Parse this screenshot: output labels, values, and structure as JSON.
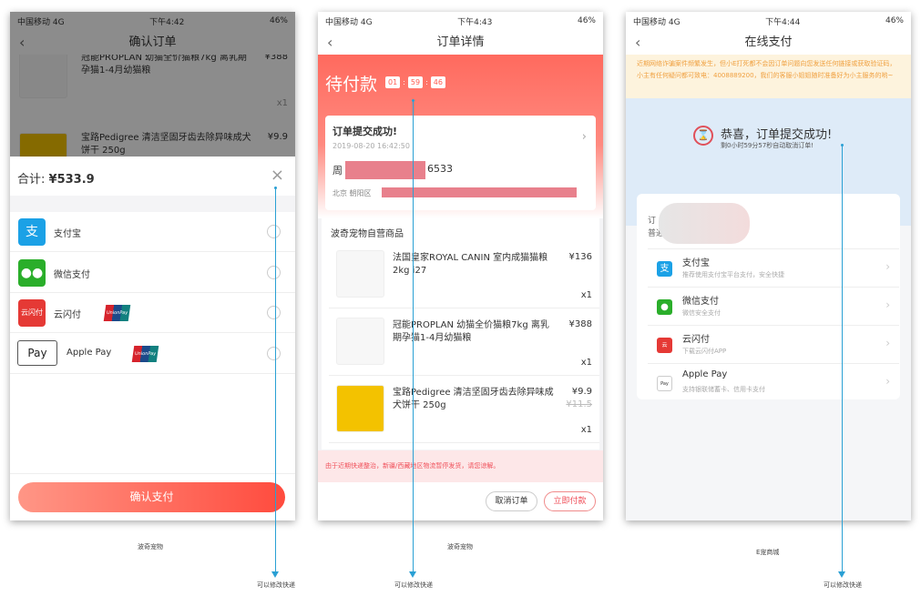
{
  "screen1": {
    "status": {
      "carrier": "中国移动",
      "network": "4G",
      "time": "下午4:42",
      "battery": "46%"
    },
    "title": "确认订单",
    "background_items": [
      {
        "name": "冠能PROPLAN 幼猫全价猫粮7kg 离乳期孕猫1-4月幼猫粮",
        "price": "¥388",
        "qty": "x1"
      },
      {
        "name": "宝路Pedigree 清洁坚固牙齿去除异味成犬饼干 250g",
        "price": "¥9.9"
      }
    ],
    "total_label": "合计:",
    "total_value": "¥533.9",
    "payment_methods": [
      {
        "label": "支付宝",
        "icon": "alipay-icon"
      },
      {
        "label": "微信支付",
        "icon": "wechat-pay-icon"
      },
      {
        "label": "云闪付",
        "icon": "cloud-quickpass-icon",
        "badge": "UnionPay 银联"
      },
      {
        "label": "Apple Pay",
        "icon": "apple-pay-icon",
        "icon_text": "Pay",
        "badge": "UnionPay 银联"
      }
    ],
    "confirm_label": "确认支付",
    "caption": "波奇宠物"
  },
  "screen2": {
    "status": {
      "carrier": "中国移动",
      "network": "4G",
      "time": "下午4:43",
      "battery": "46%"
    },
    "title": "订单详情",
    "pending_label": "待付款",
    "countdown": [
      "01",
      "59",
      "46"
    ],
    "order_success": "订单提交成功!",
    "order_time": "2019-08-20 16:42:50",
    "recipient_prefix": "周",
    "recipient_suffix": "6533",
    "address_prefix": "北京 朝阳区",
    "store_name": "波奇宠物自营商品",
    "products": [
      {
        "name": "法国皇家ROYAL CANIN 室内成猫猫粮2kg i27",
        "price": "¥136",
        "qty": "x1"
      },
      {
        "name": "冠能PROPLAN 幼猫全价猫粮7kg 离乳期孕猫1-4月幼猫粮",
        "price": "¥388",
        "qty": "x1"
      },
      {
        "name": "宝路Pedigree 清洁坚固牙齿去除异味成犬饼干 250g",
        "price": "¥9.9",
        "original_price": "¥11.5",
        "qty": "x1"
      }
    ],
    "notice": "由于近期快递整治，新疆/西藏地区物流暂停发货，请您谅解。",
    "cancel_label": "取消订单",
    "pay_label": "立即付款",
    "caption": "波奇宠物"
  },
  "screen3": {
    "status": {
      "carrier": "中国移动",
      "network": "4G",
      "time": "下午4:44",
      "battery": "46%"
    },
    "title": "在线支付",
    "warning": "近期网络诈骗案件频繁发生，但小E打死都不会因订单问题向您发送任何链接或获取验证码，小主有任何疑问都可致电：4008889200，我们的客服小姐姐随时准备好为小主服务的哟~",
    "success_title": "恭喜，订单提交成功!",
    "success_sub": "剩0小时59分57秒自动取消订单!",
    "order_label_partial": "订",
    "delivery_label_partial": "普通",
    "payment_methods": [
      {
        "label": "支付宝",
        "sub": "推荐使用支付宝平台支付，安全快捷",
        "icon": "alipay-icon"
      },
      {
        "label": "微信支付",
        "sub": "微信安全支付",
        "icon": "wechat-pay-icon"
      },
      {
        "label": "云闪付",
        "sub": "下载云闪付APP",
        "icon": "cloud-quickpass-icon"
      },
      {
        "label": "Apple Pay",
        "sub": "支持银联储蓄卡、信用卡支付",
        "icon": "apple-pay-icon"
      }
    ],
    "caption": "E宠商城"
  },
  "annotation": "可以修改快递",
  "colors": {
    "accent_red": "#ff5a4f",
    "link_blue": "#2aa0d4",
    "alipay": "#1ba1e6",
    "wechat": "#2aae2a"
  }
}
